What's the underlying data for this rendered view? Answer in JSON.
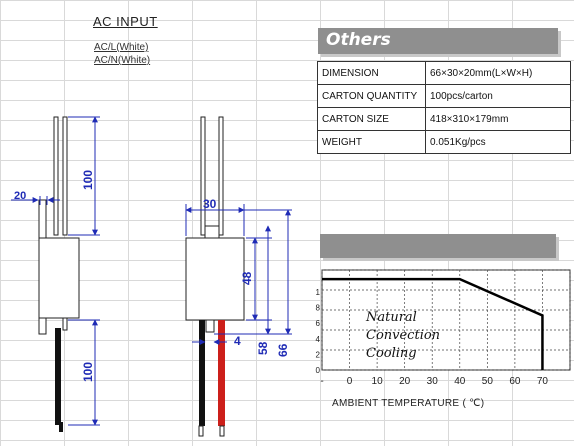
{
  "ac_input": {
    "title": "AC INPUT",
    "line1": "AC/L(White)",
    "line2": "AC/N(White)"
  },
  "dimensions_drawing": {
    "dim_20": "20",
    "dim_100_top": "100",
    "dim_100_bottom": "100",
    "dim_30": "30",
    "dim_48": "48",
    "dim_4": "4",
    "dim_58": "58",
    "dim_66": "66",
    "colors": {
      "dimension": "#1f2bb5",
      "wire_black": "#111111",
      "wire_red": "#cc1f1a"
    }
  },
  "others": {
    "title": "Others",
    "rows": [
      {
        "key": "DIMENSION",
        "value": "66×30×20mm(L×W×H)"
      },
      {
        "key": "CARTON QUANTITY",
        "value": "100pcs/carton"
      },
      {
        "key": "CARTON SIZE",
        "value": "418×310×179mm"
      },
      {
        "key": "WEIGHT",
        "value": "0.051Kg/pcs"
      }
    ]
  },
  "chart_data": {
    "type": "line",
    "title": "",
    "xlabel": "AMBIENT TEMPERATURE ( ℃)",
    "ylabel": "",
    "x_ticks": [
      "-",
      "0",
      "10",
      "20",
      "30",
      "40",
      "50",
      "60",
      "70"
    ],
    "y_ticks": [
      "1",
      "8",
      "6",
      "4",
      "2",
      "0"
    ],
    "series": [
      {
        "x": [
          -10,
          40,
          70,
          70
        ],
        "y": [
          1.0,
          1.0,
          0.6,
          0.0
        ]
      }
    ],
    "xlim": [
      -10,
      80
    ],
    "ylim": [
      0,
      1.1
    ],
    "grid": true,
    "annotation_lines": [
      "Natural",
      "Convection",
      "Cooling"
    ]
  }
}
